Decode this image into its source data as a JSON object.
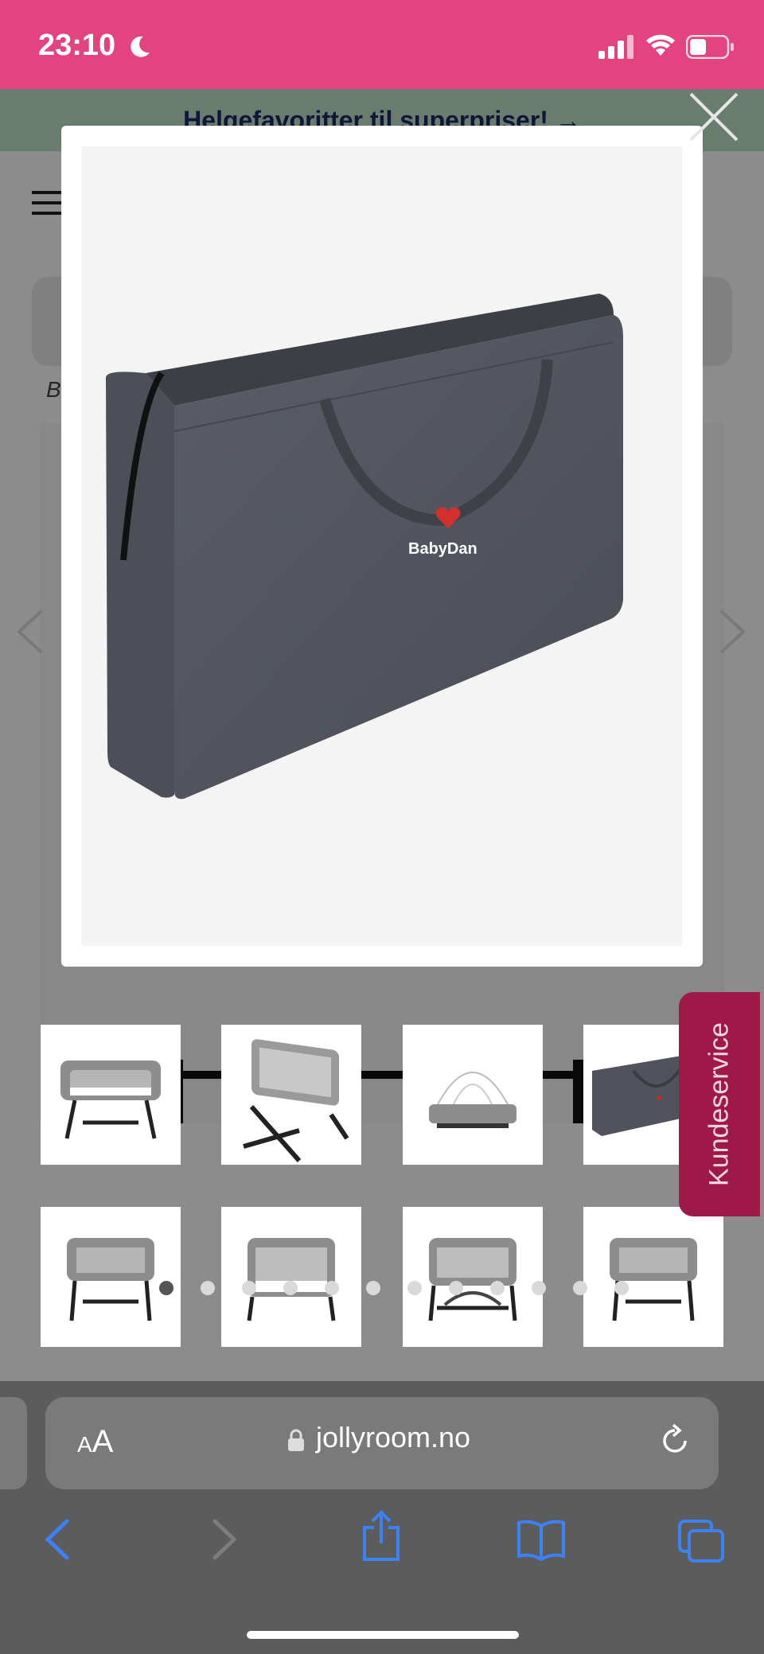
{
  "status_bar": {
    "time": "23:10",
    "background": "#e3447f"
  },
  "page": {
    "promo_banner": "Helgefavoritter til superpriser! →",
    "breadcrumb": "B"
  },
  "modal": {
    "image_brand": "BabyDan",
    "image_alt": "Grey BabyDan carry bag"
  },
  "thumbnails": [
    {
      "name": "bedside crib front view"
    },
    {
      "name": "bedside crib side view"
    },
    {
      "name": "crib with mosquito net"
    },
    {
      "name": "carry bag"
    },
    {
      "name": "crib low position"
    },
    {
      "name": "crib front view"
    },
    {
      "name": "crib with lower shelf"
    },
    {
      "name": "crib side view"
    }
  ],
  "carousel": {
    "dot_count": 12,
    "active_index": 0
  },
  "kundeservice": {
    "label": "Kundeservice",
    "color": "#9e1848"
  },
  "safari": {
    "aa": "AA",
    "url": "jollyroom.no",
    "accent": "#3b82f6"
  }
}
